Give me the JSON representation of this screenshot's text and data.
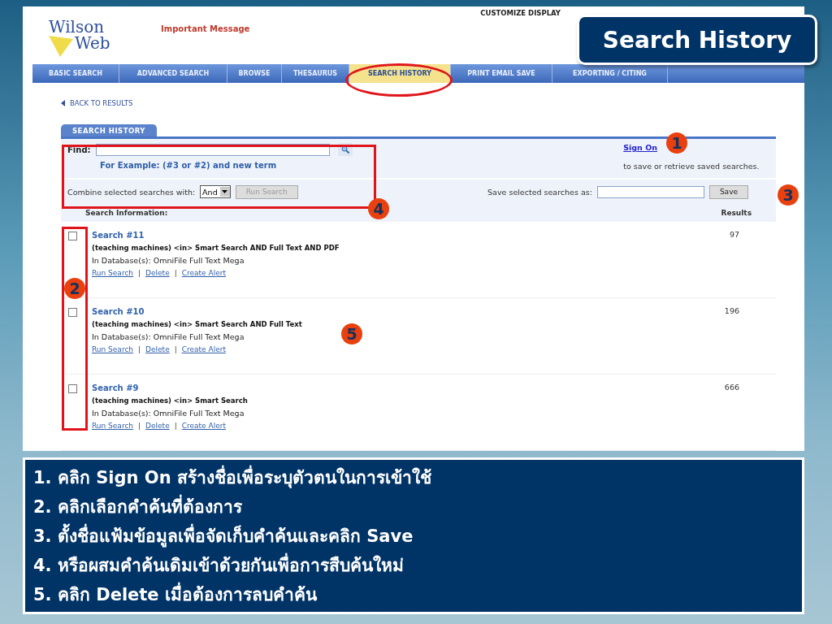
{
  "slide_title": "Search History",
  "header": {
    "logo_top": "Wilson",
    "logo_bottom": "Web",
    "message": "Important Message",
    "top_links": [
      "CUSTOMIZE DISPLAY"
    ]
  },
  "nav_tabs": [
    {
      "label": "BASIC SEARCH",
      "selected": false
    },
    {
      "label": "ADVANCED SEARCH",
      "selected": false
    },
    {
      "label": "BROWSE",
      "selected": false
    },
    {
      "label": "THESAURUS",
      "selected": false
    },
    {
      "label": "SEARCH HISTORY",
      "selected": true
    },
    {
      "label": "PRINT EMAIL SAVE",
      "selected": false
    },
    {
      "label": "EXPORTING / CITING",
      "selected": false
    }
  ],
  "back_link": "BACK TO RESULTS",
  "panel_tab": "SEARCH HISTORY",
  "find": {
    "label": "Find:",
    "example": "For Example: (#3 or #2) and new term"
  },
  "sign_on": {
    "link": "Sign On",
    "text": "to save or retrieve saved searches."
  },
  "combine": {
    "label": "Combine selected searches with:",
    "value": "And",
    "button": "Run Search",
    "disabled": true
  },
  "save": {
    "label": "Save selected searches as:",
    "button": "Save"
  },
  "columns": [
    "Search Information:",
    "Results"
  ],
  "searches": [
    {
      "title": "Search #11",
      "query": "(teaching machines) <in> Smart Search AND Full Text AND PDF",
      "database": "In Database(s): OmniFile Full Text Mega",
      "actions": [
        "Run Search",
        "Delete",
        "Create Alert"
      ],
      "separators": [
        "|",
        "|"
      ],
      "results": "97",
      "checked": false
    },
    {
      "title": "Search #10",
      "query": "(teaching machines) <in> Smart Search AND Full Text",
      "database": "In Database(s): OmniFile Full Text Mega",
      "actions": [
        "Run Search",
        "Delete",
        "Create Alert"
      ],
      "separators": [
        "|",
        "|"
      ],
      "results": "196",
      "checked": false
    },
    {
      "title": "Search #9",
      "query": "(teaching machines) <in> Smart Search",
      "database": "In Database(s): OmniFile Full Text Mega",
      "actions": [
        "Run Search",
        "Delete",
        "Create Alert"
      ],
      "separators": [
        "|",
        "|"
      ],
      "results": "666",
      "checked": false
    }
  ],
  "callouts": [
    "1",
    "2",
    "3",
    "4",
    "5"
  ],
  "instructions": [
    "1. คลิก Sign On สร้างชื่อเพื่อระบุตัวตนในการเข้าใช้",
    "2. คลิกเลือกคำค้นที่ต้องการ",
    "3. ตั้งชื่อแฟ้มข้อมูลเพื่อจัดเก็บคำค้นและคลิก Save",
    "4. หรือผสมคำค้นเดิมเข้าด้วยกันเพื่อการสืบค้นใหม่",
    "5. คลิก Delete เมื่อต้องการลบคำค้น"
  ]
}
